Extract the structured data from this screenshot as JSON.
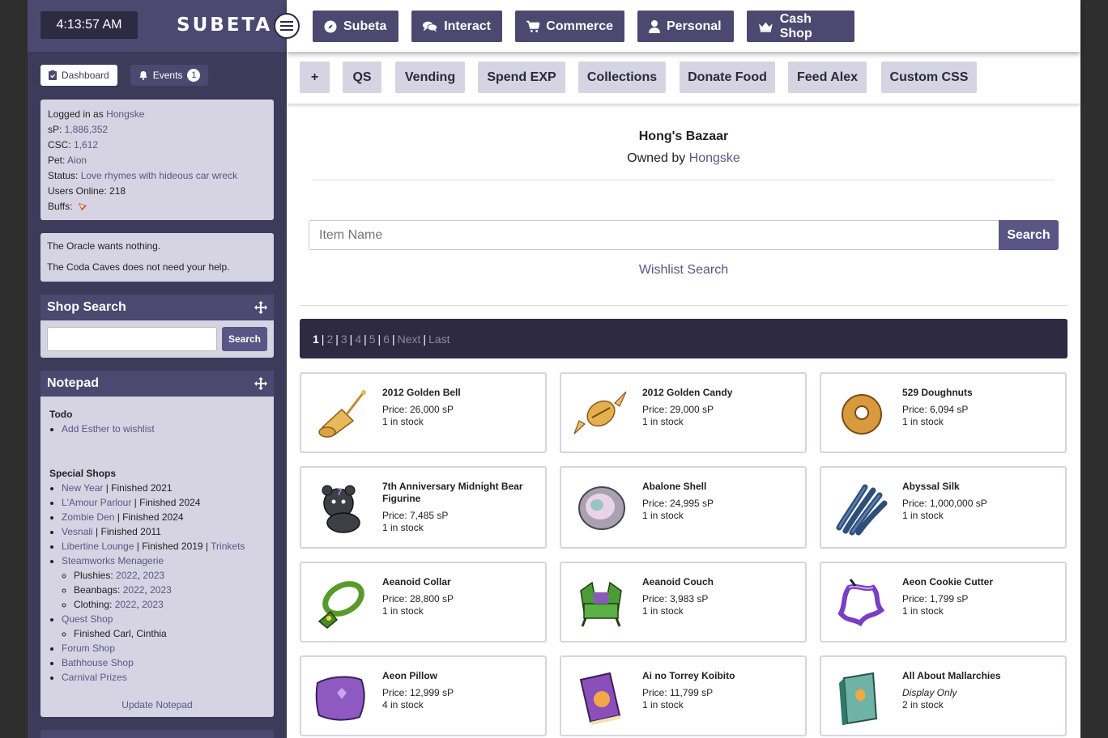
{
  "sidebar": {
    "clock": "4:13:57 AM",
    "logo": "SUBETA",
    "dashboard_label": "Dashboard",
    "events_label": "Events",
    "events_count": "1",
    "user": {
      "logged_prefix": "Logged in as ",
      "username": "Hongske",
      "sp_label": "sP: ",
      "sp_value": "1,886,352",
      "csc_label": "CSC: ",
      "csc_value": "1,612",
      "pet_label": "Pet: ",
      "pet_value": "Aion",
      "status_label": "Status: ",
      "status_value": "Love rhymes with hideous car wreck",
      "online_label": "Users Online: ",
      "online_value": "218",
      "buffs_label": "Buffs:"
    },
    "oracle": {
      "line1": "The Oracle wants nothing.",
      "line2": "The Coda Caves does not need your help."
    },
    "shop_search": {
      "title": "Shop Search",
      "button": "Search"
    },
    "notepad": {
      "title": "Notepad",
      "todo_heading": "Todo",
      "todo_item": "Add Esther to wishlist",
      "special_heading": "Special Shops",
      "shops": {
        "new_year": "New Year",
        "new_year_status": " | Finished 2021",
        "lamour": "L'Amour Parlour",
        "lamour_status": " | Finished 2024",
        "zombie": "Zombie Den",
        "zombie_status": " | Finished 2024",
        "vesnali": "Vesnali",
        "vesnali_status": " | Finished 2011",
        "libertine": "Libertine Lounge",
        "libertine_status": " | Finished 2019 | ",
        "trinkets": "Trinkets",
        "steamworks": "Steamworks Menagerie",
        "plushies_label": "Plushies: ",
        "beanbags_label": "Beanbags: ",
        "clothing_label": "Clothing: ",
        "y2022": "2022",
        "y2023": "2023",
        "comma": ", ",
        "quest": "Quest Shop",
        "quest_sub": "Finished Carl, Cinthia",
        "forum": "Forum Shop",
        "bathhouse": "Bathhouse Shop",
        "carnival": "Carnival Prizes"
      },
      "update_label": "Update Notepad"
    }
  },
  "topnav": [
    {
      "label": "Subeta",
      "icon": "compass-icon"
    },
    {
      "label": "Interact",
      "icon": "chat-icon"
    },
    {
      "label": "Commerce",
      "icon": "cart-icon"
    },
    {
      "label": "Personal",
      "icon": "user-icon"
    },
    {
      "label": "Cash Shop",
      "icon": "crown-icon"
    }
  ],
  "subnav": [
    "+",
    "QS",
    "Vending",
    "Spend EXP",
    "Collections",
    "Donate Food",
    "Feed Alex",
    "Custom CSS"
  ],
  "shop": {
    "title": "Hong's Bazaar",
    "owned_prefix": "Owned by ",
    "owner": "Hongske",
    "search_placeholder": "Item Name",
    "search_button": "Search",
    "wishlist_label": "Wishlist Search"
  },
  "pager": {
    "current": "1",
    "pages": [
      "2",
      "3",
      "4",
      "5",
      "6"
    ],
    "next": "Next",
    "last": "Last",
    "sep": "|"
  },
  "items": [
    {
      "name": "2012 Golden Bell",
      "price": "Price: 26,000 sP",
      "stock": "1 in stock",
      "icon": "golden-bell-icon"
    },
    {
      "name": "2012 Golden Candy",
      "price": "Price: 29,000 sP",
      "stock": "1 in stock",
      "icon": "golden-candy-icon"
    },
    {
      "name": "529 Doughnuts",
      "price": "Price: 6,094 sP",
      "stock": "1 in stock",
      "icon": "doughnut-icon"
    },
    {
      "name": "7th Anniversary Midnight Bear Figurine",
      "price": "Price: 7,485 sP",
      "stock": "1 in stock",
      "icon": "bear-figurine-icon"
    },
    {
      "name": "Abalone Shell",
      "price": "Price: 24,995 sP",
      "stock": "1 in stock",
      "icon": "shell-icon"
    },
    {
      "name": "Abyssal Silk",
      "price": "Price: 1,000,000 sP",
      "stock": "1 in stock",
      "icon": "silk-icon"
    },
    {
      "name": "Aeanoid Collar",
      "price": "Price: 28,800 sP",
      "stock": "1 in stock",
      "icon": "collar-icon"
    },
    {
      "name": "Aeanoid Couch",
      "price": "Price: 3,983 sP",
      "stock": "1 in stock",
      "icon": "couch-icon"
    },
    {
      "name": "Aeon Cookie Cutter",
      "price": "Price: 1,799 sP",
      "stock": "1 in stock",
      "icon": "cookie-cutter-icon"
    },
    {
      "name": "Aeon Pillow",
      "price": "Price: 12,999 sP",
      "stock": "4 in stock",
      "icon": "pillow-icon"
    },
    {
      "name": "Ai no Torrey Koibito",
      "price": "Price: 11,799 sP",
      "stock": "1 in stock",
      "icon": "book-icon"
    },
    {
      "name": "All About Mallarchies",
      "price": "Display Only",
      "stock": "2 in stock",
      "icon": "book-green-icon"
    }
  ],
  "colors": {
    "sidebar": "#3e3a5a",
    "accent": "#4c4870",
    "panel": "#d6d4e2",
    "link": "#5a5585",
    "pager": "#2d2a42"
  }
}
